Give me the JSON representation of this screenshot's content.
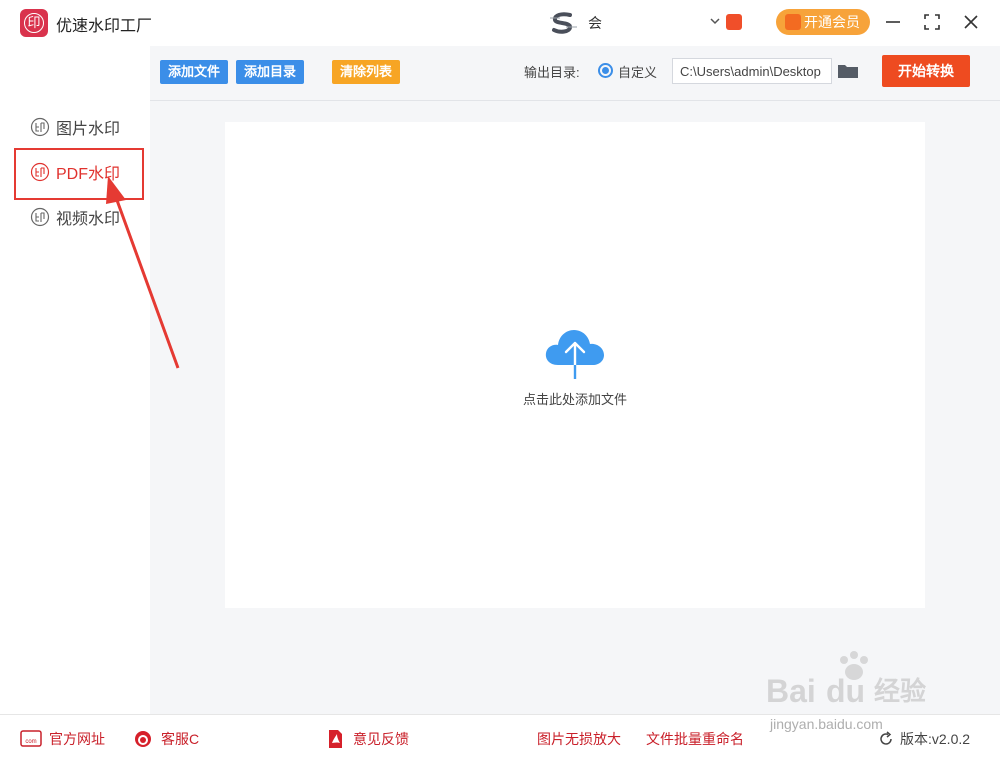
{
  "app": {
    "title": "优速水印工厂",
    "logo_char": "印",
    "user_display": "会",
    "vip_button": "开通会员"
  },
  "sidebar": {
    "items": [
      {
        "label": "图片水印",
        "active": false
      },
      {
        "label": "PDF水印",
        "active": true
      },
      {
        "label": "视频水印",
        "active": false
      }
    ]
  },
  "toolbar": {
    "add_file": "添加文件",
    "add_dir": "添加目录",
    "clear_list": "清除列表",
    "output_label": "输出目录:",
    "output_option": "自定义",
    "output_path": "C:\\Users\\admin\\Desktop",
    "start": "开始转换"
  },
  "dropzone": {
    "hint": "点击此处添加文件"
  },
  "footer": {
    "website": "官方网址",
    "service": "客服C",
    "feedback": "意见反馈",
    "lossless_enlarge": "图片无损放大",
    "batch_rename": "文件批量重命名",
    "version_label": "版本:v2.0.2"
  },
  "watermark": {
    "brand": "Baidu经验",
    "url": "jingyan.baidu.com"
  },
  "colors": {
    "accent_red": "#e0322e",
    "button_blue": "#3b8ee8",
    "button_orange": "#f7a524",
    "start_button": "#ee4b20",
    "vip_orange": "#f7a33a"
  }
}
